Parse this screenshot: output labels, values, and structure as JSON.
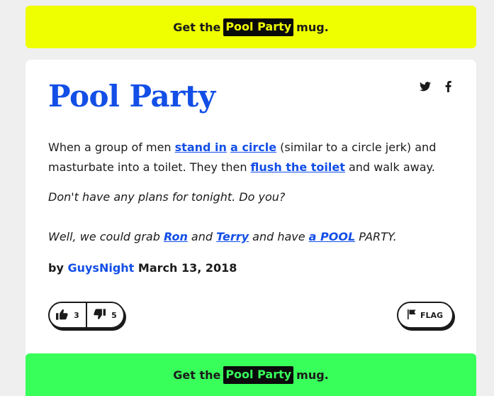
{
  "top_banner": {
    "prefix": "Get the",
    "highlight": "Pool Party",
    "suffix": "mug."
  },
  "definition": {
    "word": "Pool Party",
    "share": {
      "twitter_icon": "twitter-icon",
      "facebook_icon": "facebook-icon"
    },
    "meaning": {
      "part1": "When a group of men ",
      "link1": "stand in",
      "part2": " ",
      "link2": "a circle",
      "part3": " (similar to a circle jerk) and masturbate into a toilet. They then ",
      "link3": "flush the toilet",
      "part4": " and walk away."
    },
    "example": {
      "line1": "Don't have any plans for tonight. Do you?",
      "line2_part1": "Well, we could grab ",
      "line2_link1": "Ron",
      "line2_part2": " and ",
      "line2_link2": "Terry",
      "line2_part3": " and have ",
      "line2_link3": "a POOL",
      "line2_part4": " PARTY."
    },
    "contributor": {
      "by": "by",
      "author": "GuysNight",
      "date": "March 13, 2018"
    },
    "votes": {
      "up_count": "3",
      "down_count": "5"
    },
    "flag_label": "FLAG"
  },
  "bottom_banner": {
    "prefix": "Get the",
    "highlight": "Pool Party",
    "suffix": "mug."
  },
  "colors": {
    "link_blue": "#134fe6",
    "top_banner_bg": "#efff00",
    "bottom_banner_bg": "#38ff5a",
    "page_bg": "#efefef"
  }
}
